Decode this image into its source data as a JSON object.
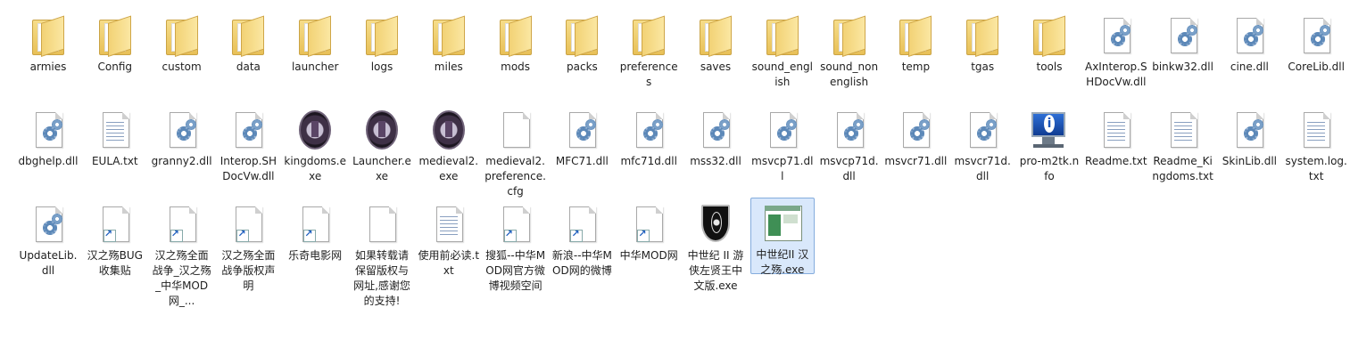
{
  "rows": [
    [
      {
        "label": "armies",
        "type": "folder"
      },
      {
        "label": "Config",
        "type": "folder"
      },
      {
        "label": "custom",
        "type": "folder"
      },
      {
        "label": "data",
        "type": "folder"
      },
      {
        "label": "launcher",
        "type": "folder"
      },
      {
        "label": "logs",
        "type": "folder"
      },
      {
        "label": "miles",
        "type": "folder"
      },
      {
        "label": "mods",
        "type": "folder"
      },
      {
        "label": "packs",
        "type": "folder"
      },
      {
        "label": "preferences",
        "type": "folder"
      },
      {
        "label": "saves",
        "type": "folder"
      },
      {
        "label": "sound_english",
        "type": "folder"
      },
      {
        "label": "sound_nonenglish",
        "type": "folder"
      },
      {
        "label": "temp",
        "type": "folder"
      },
      {
        "label": "tgas",
        "type": "folder"
      },
      {
        "label": "tools",
        "type": "folder"
      },
      {
        "label": "AxInterop.SHDocVw.dll",
        "type": "dll"
      },
      {
        "label": "binkw32.dll",
        "type": "dll"
      },
      {
        "label": "cine.dll",
        "type": "dll"
      },
      {
        "label": "CoreLib.dll",
        "type": "dll"
      }
    ],
    [
      {
        "label": "dbghelp.dll",
        "type": "dll"
      },
      {
        "label": "EULA.txt",
        "type": "txt"
      },
      {
        "label": "granny2.dll",
        "type": "dll"
      },
      {
        "label": "Interop.SHDocVw.dll",
        "type": "dll"
      },
      {
        "label": "kingdoms.exe",
        "type": "emblem"
      },
      {
        "label": "Launcher.exe",
        "type": "emblem"
      },
      {
        "label": "medieval2.exe",
        "type": "emblem"
      },
      {
        "label": "medieval2.preference.cfg",
        "type": "blank"
      },
      {
        "label": "MFC71.dll",
        "type": "dll"
      },
      {
        "label": "mfc71d.dll",
        "type": "dll"
      },
      {
        "label": "mss32.dll",
        "type": "dll"
      },
      {
        "label": "msvcp71.dll",
        "type": "dll"
      },
      {
        "label": "msvcp71d.dll",
        "type": "dll"
      },
      {
        "label": "msvcr71.dll",
        "type": "dll"
      },
      {
        "label": "msvcr71d.dll",
        "type": "dll"
      },
      {
        "label": "pro-m2tk.nfo",
        "type": "monitor"
      },
      {
        "label": "Readme.txt",
        "type": "txt"
      },
      {
        "label": "Readme_Kingdoms.txt",
        "type": "txt"
      },
      {
        "label": "SkinLib.dll",
        "type": "dll"
      },
      {
        "label": "system.log.txt",
        "type": "txt"
      }
    ],
    [
      {
        "label": "UpdateLib.dll",
        "type": "dll"
      },
      {
        "label": "汉之殇BUG收集贴",
        "type": "shortcut"
      },
      {
        "label": "汉之殇全面战争_汉之殇_中华MOD网_...",
        "type": "shortcut"
      },
      {
        "label": "汉之殇全面战争版权声明",
        "type": "shortcut"
      },
      {
        "label": "乐奇电影网",
        "type": "shortcut"
      },
      {
        "label": "如果转载请保留版权与网址,感谢您的支持!",
        "type": "blank"
      },
      {
        "label": "使用前必读.txt",
        "type": "txt"
      },
      {
        "label": "搜狐--中华MOD网官方微博视频空间",
        "type": "shortcut"
      },
      {
        "label": "新浪--中华MOD网的微博",
        "type": "shortcut"
      },
      {
        "label": "中华MOD网",
        "type": "shortcut"
      },
      {
        "label": "中世纪 II 游侠左贤王中文版.exe",
        "type": "shield"
      },
      {
        "label": "中世纪II 汉之殇.exe",
        "type": "window",
        "selected": true
      }
    ]
  ]
}
